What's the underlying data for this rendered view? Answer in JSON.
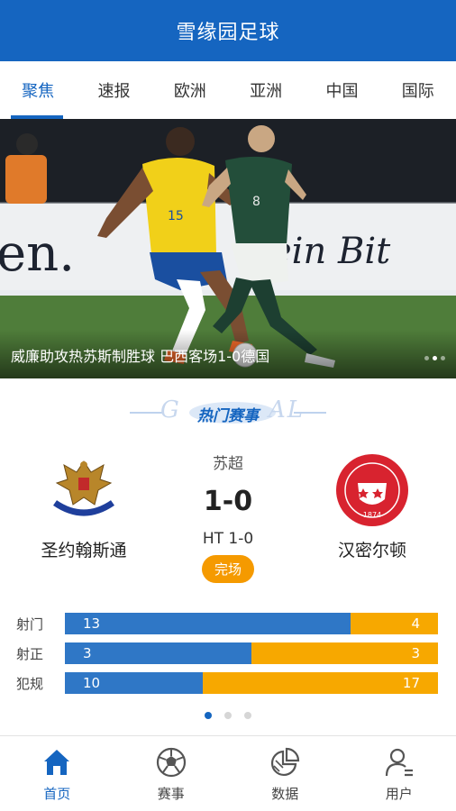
{
  "header": {
    "title": "雪缘园足球"
  },
  "tabs": [
    {
      "label": "聚焦",
      "active": true
    },
    {
      "label": "速报",
      "active": false
    },
    {
      "label": "欧洲",
      "active": false
    },
    {
      "label": "亚洲",
      "active": false
    },
    {
      "label": "中国",
      "active": false
    },
    {
      "label": "国际",
      "active": false
    }
  ],
  "hero": {
    "caption": "威廉助攻热苏斯制胜球 巴西客场1-0德国",
    "billboard_text": "en.    ein Bit",
    "player_left_number": "15",
    "player_right_number": "8",
    "slide_count": 3,
    "active_slide": 2
  },
  "section": {
    "label": "热门赛事",
    "deco_left": "G",
    "deco_right": "AL"
  },
  "match": {
    "league": "苏超",
    "score": "1-0",
    "halftime": "HT 1-0",
    "status": "完场",
    "home": {
      "name": "圣约翰斯通",
      "badge_text": "ST JOHNSTONE FC"
    },
    "away": {
      "name": "汉密尔顿",
      "badge_text": "HAMILTON ACADEMICAL FOOTBALL CLUB",
      "badge_year": "1874"
    }
  },
  "stats": [
    {
      "label": "射门",
      "home": "13",
      "away": "4"
    },
    {
      "label": "射正",
      "home": "3",
      "away": "3"
    },
    {
      "label": "犯规",
      "home": "10",
      "away": "17"
    }
  ],
  "pager": {
    "count": 3,
    "active": 0
  },
  "bottom_nav": [
    {
      "label": "首页",
      "icon": "home-icon",
      "active": true
    },
    {
      "label": "赛事",
      "icon": "soccer-ball-icon",
      "active": false
    },
    {
      "label": "数据",
      "icon": "pie-chart-icon",
      "active": false
    },
    {
      "label": "用户",
      "icon": "user-icon",
      "active": false
    }
  ],
  "colors": {
    "primary": "#1565c0",
    "home_bar": "#2f77c6",
    "away_bar": "#f7a800",
    "status": "#f59a00"
  }
}
